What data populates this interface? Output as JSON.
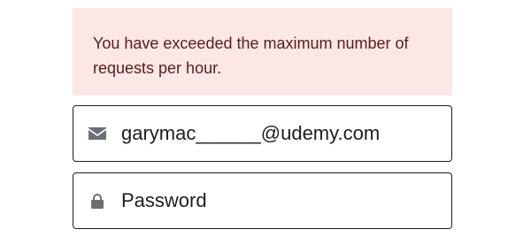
{
  "alert": {
    "message": "You have exceeded the maximum number of requests per hour."
  },
  "email": {
    "icon": "envelope-icon",
    "value": "garymac______@udemy.com"
  },
  "password": {
    "icon": "lock-icon",
    "placeholder": "Password",
    "value": ""
  }
}
